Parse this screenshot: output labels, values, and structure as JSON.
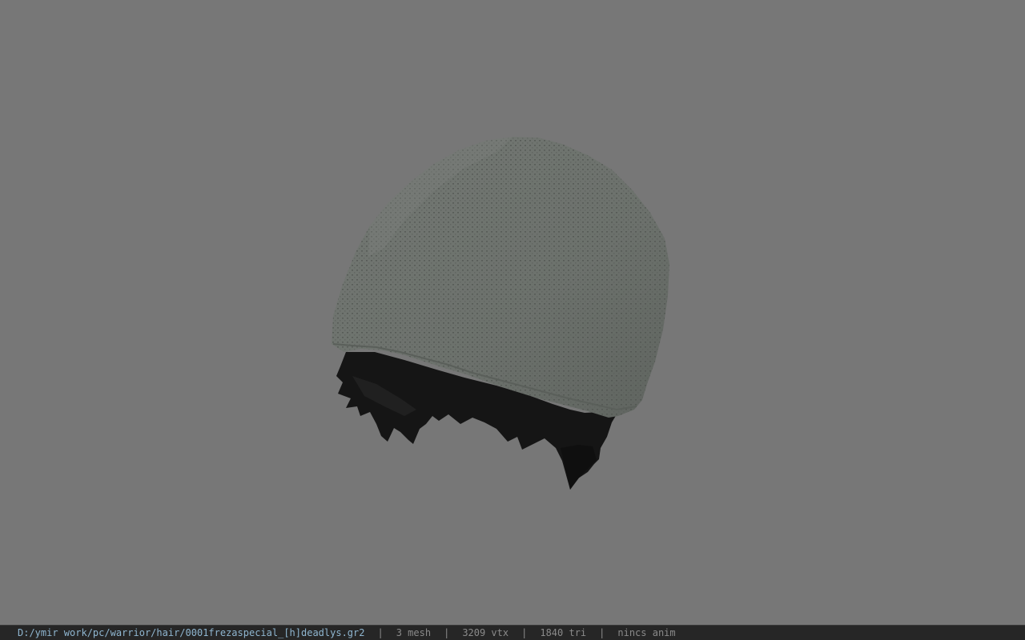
{
  "viewer": {
    "background_color": "#777777",
    "model": {
      "cap_color": "#6e736e",
      "hair_color": "#141414"
    }
  },
  "statusbar": {
    "file_path": "D:/ymir work/pc/warrior/hair/0001frezaspecial_[h]deadlys.gr2",
    "separator": "|",
    "mesh_count": "3 mesh",
    "vertex_count": "3209 vtx",
    "triangle_count": "1840 tri",
    "anim_status": "nincs anim",
    "path_color": "#8fb6d0",
    "text_color": "#8a8a8a"
  }
}
